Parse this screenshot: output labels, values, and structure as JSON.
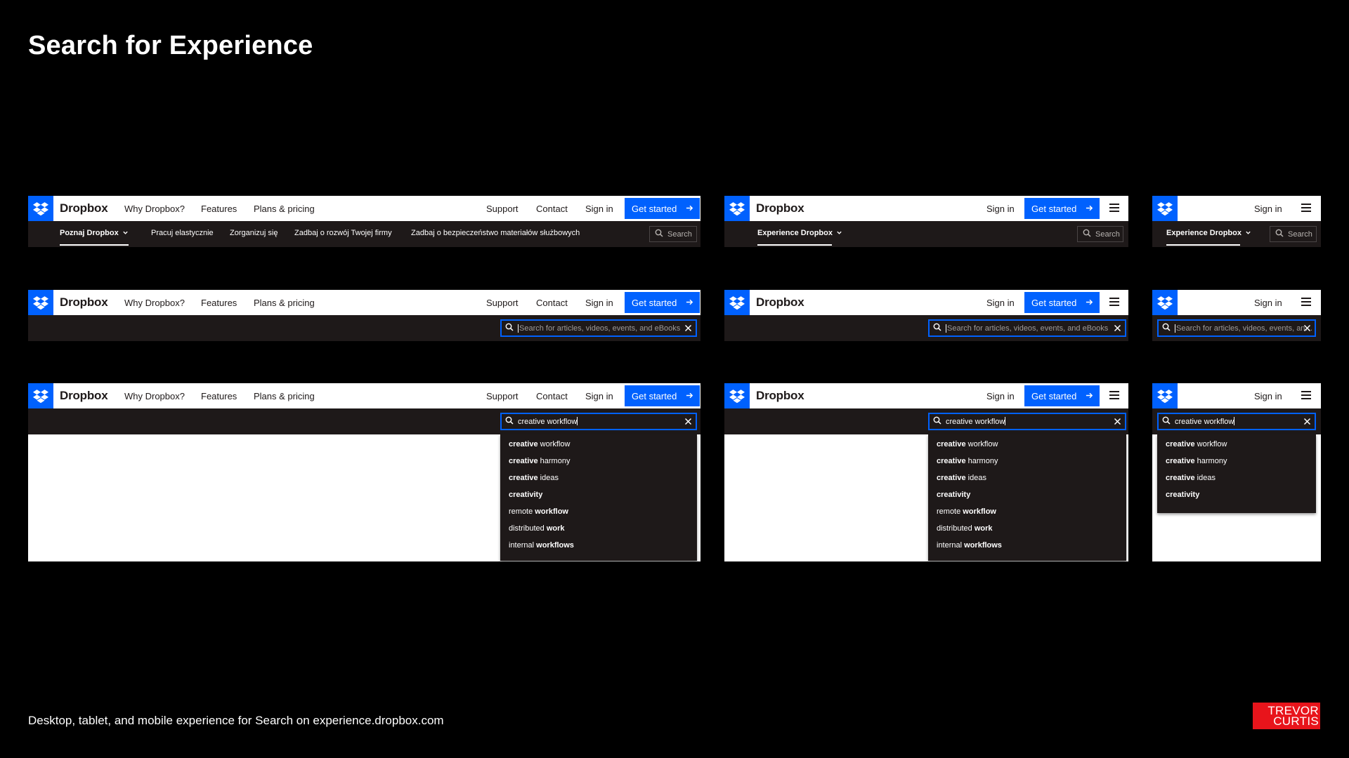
{
  "page": {
    "title": "Search for Experience",
    "caption": "Desktop, tablet, and mobile experience for Search on experience.dropbox.com",
    "brand": [
      "TREVOR",
      "CURTIS"
    ]
  },
  "nav": {
    "brand": "Dropbox",
    "links": [
      "Why Dropbox?",
      "Features",
      "Plans & pricing"
    ],
    "support": "Support",
    "contact": "Contact",
    "sign_in": "Sign in",
    "get_started": "Get started"
  },
  "secondary_nav": {
    "desktop_items": [
      "Poznaj Dropbox",
      "Pracuj elastycznie",
      "Zorganizuj się",
      "Zadbaj o rozwój Twojej firmy",
      "Zadbaj o bezpieczeństwo materiałów służbowych"
    ],
    "tablet_item": "Experience Dropbox",
    "mobile_item": "Experience Dropbox"
  },
  "search": {
    "button_label": "Search",
    "placeholder": "Search for articles, videos, events, and eBooks",
    "query": "creative workflow"
  },
  "suggestions": [
    {
      "bold": "creative",
      "rest": " workflow",
      "bold_first": true
    },
    {
      "bold": "creative",
      "rest": " harmony",
      "bold_first": true
    },
    {
      "bold": "creative",
      "rest": " ideas",
      "bold_first": true
    },
    {
      "bold": "creativity",
      "rest": "",
      "bold_first": true
    },
    {
      "bold": "workflow",
      "rest": "remote ",
      "bold_first": false
    },
    {
      "bold": "work",
      "rest": "distributed ",
      "bold_first": false
    },
    {
      "bold": "workflows",
      "rest": "internal ",
      "bold_first": false
    }
  ],
  "colors": {
    "accent": "#0061fe",
    "dark_bar": "#1e1919",
    "brand_red": "#e8141b"
  },
  "icons": [
    "dropbox-logo-icon",
    "arrow-right-icon",
    "hamburger-menu-icon",
    "chevron-down-icon",
    "search-icon",
    "close-icon"
  ]
}
